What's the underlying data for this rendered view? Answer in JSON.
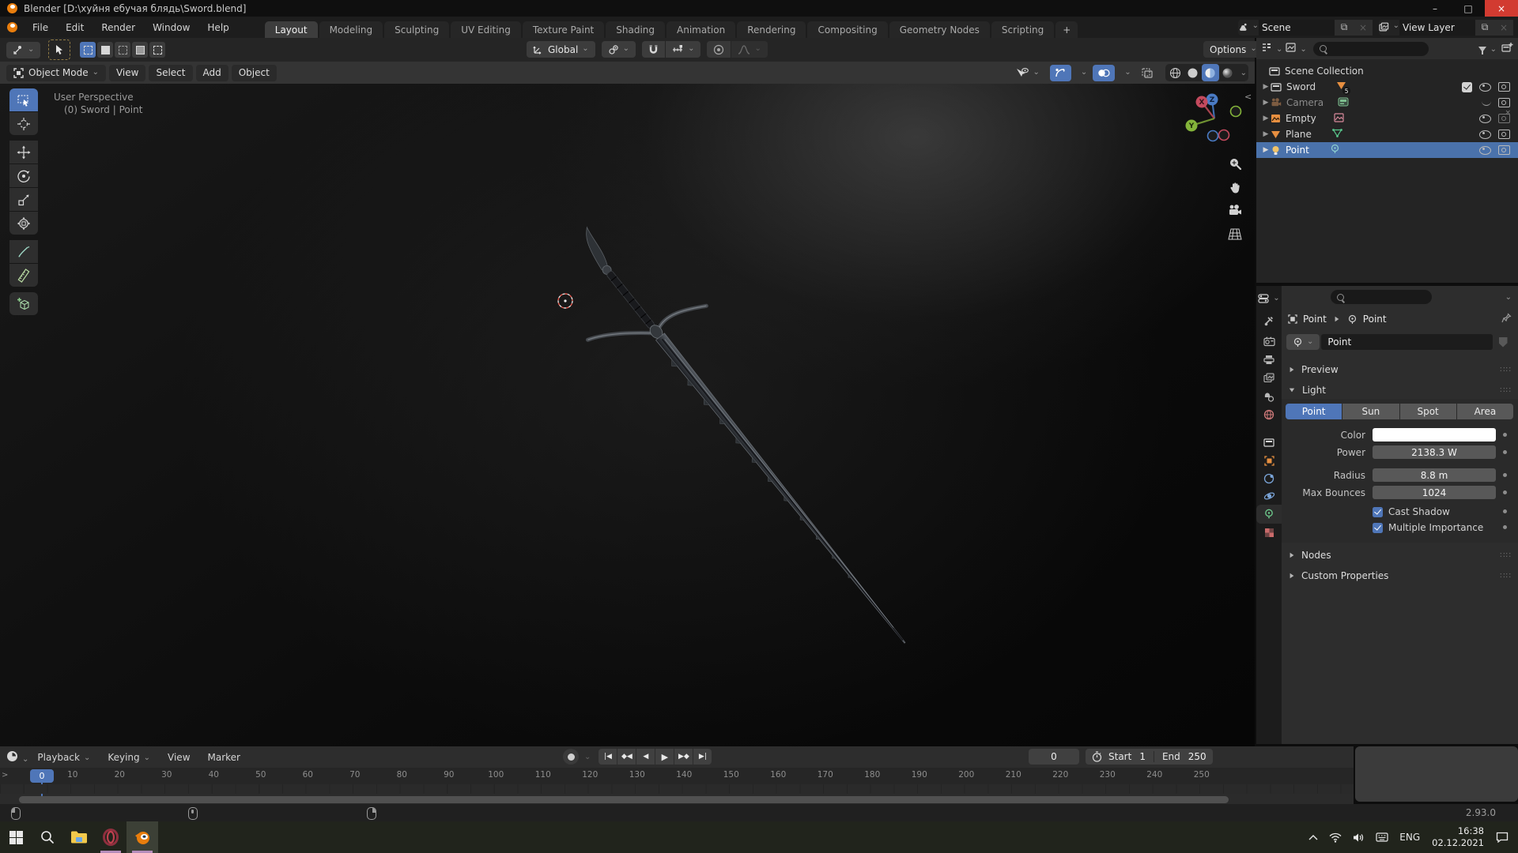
{
  "window": {
    "title": "Blender [D:\\хуйня ебучая блядь\\Sword.blend]",
    "minimize": "–",
    "maximize": "□",
    "close": "×"
  },
  "topbar": {
    "menus": [
      "File",
      "Edit",
      "Render",
      "Window",
      "Help"
    ],
    "active_tab": "Layout",
    "tabs_rest": [
      "Modeling",
      "Sculpting",
      "UV Editing",
      "Texture Paint",
      "Shading",
      "Animation",
      "Rendering",
      "Compositing",
      "Geometry Nodes",
      "Scripting"
    ],
    "add_tab": "+",
    "scene": "Scene",
    "view_layer": "View Layer"
  },
  "tool_settings": {
    "orientation": "Global",
    "options": "Options"
  },
  "viewport": {
    "mode": "Object Mode",
    "menus": [
      "View",
      "Select",
      "Add",
      "Object"
    ],
    "overlay": [
      "User Perspective",
      "(0) Sword | Point"
    ],
    "axes": {
      "x": "X",
      "y": "Y",
      "z": "Z"
    }
  },
  "outliner": {
    "root": "Scene Collection",
    "rows": [
      {
        "name": "Sword",
        "count": "5"
      },
      {
        "name": "Camera"
      },
      {
        "name": "Empty"
      },
      {
        "name": "Plane"
      },
      {
        "name": "Point"
      }
    ]
  },
  "properties": {
    "breadcrumb": {
      "object": "Point",
      "data": "Point"
    },
    "name_field": "Point",
    "panels": {
      "preview": "Preview",
      "light": "Light",
      "nodes": "Nodes",
      "custom": "Custom Properties"
    },
    "light_active": "Point",
    "light_rest": [
      "Sun",
      "Spot",
      "Area"
    ],
    "fields": {
      "color_label": "Color",
      "power_label": "Power",
      "power_value": "2138.3 W",
      "radius_label": "Radius",
      "radius_value": "8.8 m",
      "bounces_label": "Max Bounces",
      "bounces_value": "1024",
      "cast_shadow": "Cast Shadow",
      "multiple_importance": "Multiple Importance"
    }
  },
  "timeline": {
    "menus": [
      "Playback",
      "Keying",
      "View",
      "Marker"
    ],
    "current_frame": "0",
    "frame_field": "0",
    "start_label": "Start",
    "start_value": "1",
    "end_label": "End",
    "end_value": "250",
    "ruler": [
      "10",
      "20",
      "30",
      "40",
      "50",
      "60",
      "70",
      "80",
      "90",
      "100",
      "110",
      "120",
      "130",
      "140",
      "150",
      "160",
      "170",
      "180",
      "190",
      "200",
      "210",
      "220",
      "230",
      "240",
      "250"
    ]
  },
  "statusbar": {
    "version": "2.93.0"
  },
  "taskbar": {
    "lang": "ENG",
    "time": "16:38",
    "date": "02.12.2021"
  }
}
